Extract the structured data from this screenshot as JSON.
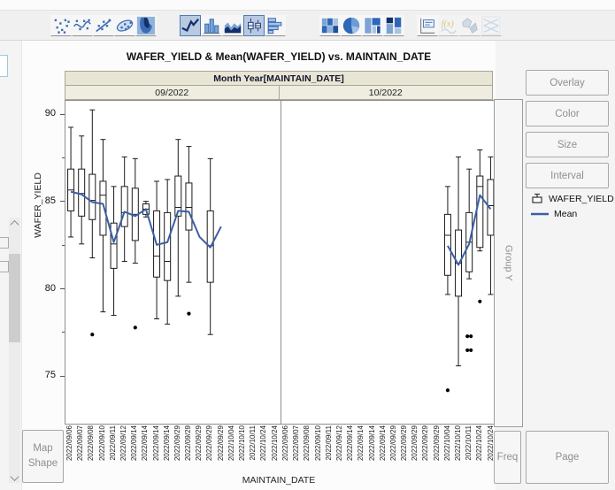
{
  "toolbar": {
    "groups": [
      {
        "items": [
          {
            "name": "points"
          },
          {
            "name": "smoother"
          },
          {
            "name": "line-of-fit"
          },
          {
            "name": "ellipse"
          },
          {
            "name": "contour"
          }
        ]
      },
      {
        "items": [
          {
            "name": "line",
            "selected": true
          },
          {
            "name": "bar"
          },
          {
            "name": "area"
          },
          {
            "name": "box-plot",
            "selected": true
          },
          {
            "name": "histogram"
          }
        ]
      },
      {
        "items": [
          {
            "name": "heatmap"
          },
          {
            "name": "pie"
          },
          {
            "name": "treemap"
          },
          {
            "name": "mosaic"
          }
        ]
      },
      {
        "items": [
          {
            "name": "caption-box"
          },
          {
            "name": "formula",
            "disabled": true
          },
          {
            "name": "map-shape",
            "disabled": true
          },
          {
            "name": "parallel",
            "disabled": true
          }
        ]
      }
    ]
  },
  "drop_zones": {
    "overlay": "Overlay",
    "color": "Color",
    "size": "Size",
    "interval": "Interval",
    "group_y": "Group Y",
    "freq": "Freq",
    "page": "Page",
    "map_shape": "Map Shape"
  },
  "legend": {
    "items": [
      {
        "glyph": "box-plot",
        "label": "WAFER_YIELD"
      },
      {
        "glyph": "line",
        "label": "Mean",
        "color": "#3b5ea6"
      }
    ]
  },
  "colors": {
    "mean_line": "#3b5ea6",
    "box_stroke": "#1a1a1a",
    "selected_icon_bg": "#b9c9e2",
    "band_bg": "#e9e5d4",
    "band2_bg": "#efece0"
  },
  "chart_data": {
    "type": "boxplot",
    "title": "WAFER_YIELD & Mean(WAFER_YIELD) vs. MAINTAIN_DATE",
    "group_header": "Month Year[MAINTAIN_DATE]",
    "panel_labels": [
      "09/2022",
      "10/2022"
    ],
    "panel_slot_ranges": [
      [
        0,
        14
      ],
      [
        15,
        19
      ]
    ],
    "xlabel": "MAINTAIN_DATE",
    "ylabel": "WAFER_YIELD",
    "ylim": [
      72.3,
      90.8
    ],
    "yticks_major": [
      90,
      85,
      80,
      75
    ],
    "yticks_minor": [
      87.5,
      82.5,
      77.5
    ],
    "grid": false,
    "legend_position": "right",
    "categories": [
      "2022/09/06",
      "2022/09/07",
      "2022/09/08",
      "2022/09/10",
      "2022/09/11",
      "2022/09/12",
      "2022/09/14",
      "2022/09/14",
      "2022/09/14",
      "2022/09/14",
      "2022/09/29",
      "2022/09/29",
      "2022/09/29",
      "2022/09/29",
      "2022/09/29",
      "2022/10/04",
      "2022/10/10",
      "2022/10/11",
      "2022/10/24",
      "2022/10/24"
    ],
    "boxes": [
      {
        "slot": 0,
        "high": 89.3,
        "q3": 86.9,
        "median": 85.7,
        "q1": 84.5,
        "low": 83.0
      },
      {
        "slot": 1,
        "high": 88.8,
        "q3": 86.9,
        "median": 85.5,
        "q1": 84.2,
        "low": 82.6
      },
      {
        "slot": 2,
        "high": 90.3,
        "q3": 86.6,
        "median": 85.1,
        "q1": 84.0,
        "low": 81.8,
        "outliers": [
          {
            "v": 77.4
          }
        ]
      },
      {
        "slot": 3,
        "high": 88.6,
        "q3": 86.2,
        "median": 85.4,
        "q1": 83.1,
        "low": 78.7
      },
      {
        "slot": 4,
        "high": 85.9,
        "q3": 83.8,
        "median": 82.6,
        "q1": 81.2,
        "low": 78.5
      },
      {
        "slot": 5,
        "high": 87.6,
        "q3": 85.9,
        "median": 84.4,
        "q1": 83.6,
        "low": 81.6
      },
      {
        "slot": 6,
        "high": 87.5,
        "q3": 85.8,
        "median": 84.3,
        "q1": 82.8,
        "low": 81.5,
        "outliers": [
          {
            "v": 77.8
          }
        ]
      },
      {
        "slot": 7,
        "high": 85.05,
        "q3": 84.9,
        "median": 84.6,
        "q1": 84.3,
        "low": 84.15
      },
      {
        "slot": 8,
        "high": 86.2,
        "q3": 84.5,
        "median": 81.9,
        "q1": 80.7,
        "low": 78.3
      },
      {
        "slot": 9,
        "high": 86.3,
        "q3": 84.4,
        "median": 81.6,
        "q1": 80.5,
        "low": 78.0
      },
      {
        "slot": 10,
        "high": 88.6,
        "q3": 86.5,
        "median": 84.7,
        "q1": 84.2,
        "low": 79.6
      },
      {
        "slot": 11,
        "high": 88.2,
        "q3": 86.1,
        "median": 84.7,
        "q1": 83.4,
        "low": 80.4,
        "outliers": [
          {
            "v": 78.6
          }
        ]
      },
      {
        "slot": 13,
        "high": 87.5,
        "q3": 84.5,
        "median": 82.5,
        "q1": 80.4,
        "low": 77.4
      },
      {
        "slot": 15,
        "high": 85.9,
        "q3": 84.3,
        "median": 83.1,
        "q1": 80.8,
        "low": 79.7,
        "outliers": [
          {
            "v": 74.2
          }
        ]
      },
      {
        "slot": 16,
        "high": 87.6,
        "q3": 83.4,
        "median": 81.5,
        "q1": 79.6,
        "low": 75.6
      },
      {
        "slot": 17,
        "high": 86.9,
        "q3": 84.4,
        "median": 82.7,
        "q1": 81.0,
        "low": 80.6,
        "outliers": [
          {
            "v": 77.3,
            "dx": -2
          },
          {
            "v": 77.3,
            "dx": 2
          },
          {
            "v": 76.5,
            "dx": -2
          },
          {
            "v": 76.5,
            "dx": 2
          }
        ]
      },
      {
        "slot": 18,
        "high": 88.0,
        "q3": 86.5,
        "median": 85.9,
        "q1": 82.4,
        "low": 82.2,
        "outliers": [
          {
            "v": 79.3
          }
        ]
      },
      {
        "slot": 19,
        "high": 87.6,
        "q3": 86.3,
        "median": 84.8,
        "q1": 83.1,
        "low": 79.7
      }
    ],
    "mean_series": {
      "name": "Mean",
      "color": "#3b5ea6",
      "points": [
        {
          "slot": 0,
          "v": 85.6
        },
        {
          "slot": 1,
          "v": 85.45
        },
        {
          "slot": 2,
          "v": 85.0
        },
        {
          "slot": 3,
          "v": 84.9
        },
        {
          "slot": 4,
          "v": 82.7
        },
        {
          "slot": 5,
          "v": 84.45
        },
        {
          "slot": 6,
          "v": 84.2
        },
        {
          "slot": 7,
          "v": 84.6
        },
        {
          "slot": 8,
          "v": 82.55
        },
        {
          "slot": 9,
          "v": 82.7
        },
        {
          "slot": 10,
          "v": 84.5
        },
        {
          "slot": 11,
          "v": 84.45
        },
        {
          "slot": 12,
          "v": 83.0
        },
        {
          "slot": 13,
          "v": 82.4
        },
        {
          "slot": 14,
          "v": 83.6
        },
        {
          "slot": 15,
          "v": 82.5
        },
        {
          "slot": 16,
          "v": 81.4
        },
        {
          "slot": 17,
          "v": 82.6
        },
        {
          "slot": 18,
          "v": 85.4
        },
        {
          "slot": 19,
          "v": 84.6
        }
      ]
    }
  }
}
